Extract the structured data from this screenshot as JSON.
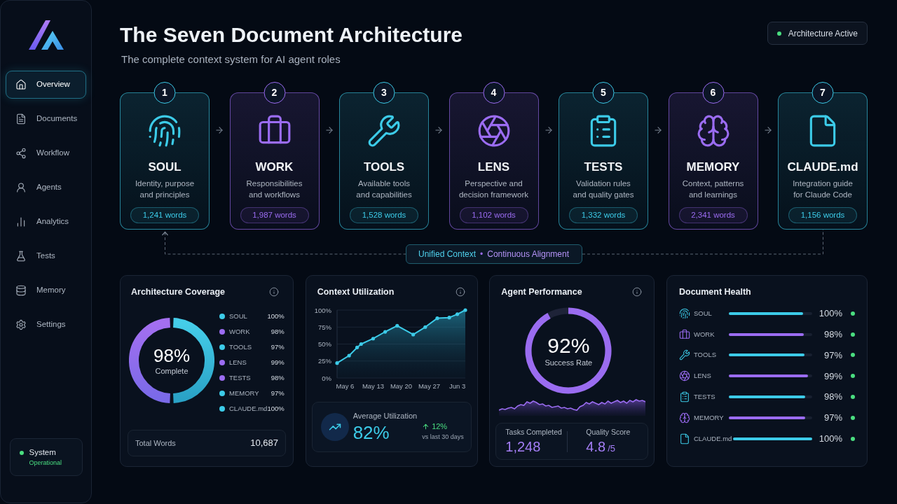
{
  "sidebar": {
    "nav": [
      {
        "label": "Overview",
        "selected": true
      },
      {
        "label": "Documents",
        "selected": false
      },
      {
        "label": "Workflow",
        "selected": false
      },
      {
        "label": "Agents",
        "selected": false
      },
      {
        "label": "Analytics",
        "selected": false
      },
      {
        "label": "Tests",
        "selected": false
      },
      {
        "label": "Memory",
        "selected": false
      },
      {
        "label": "Settings",
        "selected": false
      }
    ],
    "status": {
      "label": "System",
      "state": "Operational"
    }
  },
  "header": {
    "title": "The Seven Document Architecture",
    "subtitle": "The complete context system for AI agent roles",
    "badge": "Architecture Active"
  },
  "documents": [
    {
      "number": "1",
      "name": "SOUL",
      "description": "Identity, purpose\nand principles",
      "words": "1,241 words",
      "color": "#3ccbe8"
    },
    {
      "number": "2",
      "name": "WORK",
      "description": "Responsibilities\nand workflows",
      "words": "1,987 words",
      "color": "#9b6cf2"
    },
    {
      "number": "3",
      "name": "TOOLS",
      "description": "Available tools\nand capabilities",
      "words": "1,528 words",
      "color": "#3ccbe8"
    },
    {
      "number": "4",
      "name": "LENS",
      "description": "Perspective and\ndecision framework",
      "words": "1,102 words",
      "color": "#9b6cf2"
    },
    {
      "number": "5",
      "name": "TESTS",
      "description": "Validation rules\nand quality gates",
      "words": "1,332 words",
      "color": "#3ccbe8"
    },
    {
      "number": "6",
      "name": "MEMORY",
      "description": "Context, patterns\nand learnings",
      "words": "2,341 words",
      "color": "#9b6cf2"
    },
    {
      "number": "7",
      "name": "CLAUDE.md",
      "description": "Integration guide\nfor Claude Code",
      "words": "1,156 words",
      "color": "#3ccbe8"
    }
  ],
  "connector": {
    "left": "Unified Context",
    "separator": "•",
    "right": "Continuous Alignment"
  },
  "coverage": {
    "title": "Architecture Coverage",
    "value": "98%",
    "caption": "Complete",
    "items": [
      {
        "name": "SOUL",
        "value": "100%",
        "color": "#3ccbe8"
      },
      {
        "name": "WORK",
        "value": "98%",
        "color": "#9b6cf2"
      },
      {
        "name": "TOOLS",
        "value": "97%",
        "color": "#3ccbe8"
      },
      {
        "name": "LENS",
        "value": "99%",
        "color": "#9b6cf2"
      },
      {
        "name": "TESTS",
        "value": "98%",
        "color": "#9b6cf2"
      },
      {
        "name": "MEMORY",
        "value": "97%",
        "color": "#3ccbe8"
      },
      {
        "name": "CLAUDE.md",
        "value": "100%",
        "color": "#3ccbe8"
      }
    ],
    "total_label": "Total Words",
    "total_value": "10,687"
  },
  "utilization": {
    "title": "Context Utilization",
    "chart_data": {
      "type": "area",
      "grid": true,
      "categories": [
        null,
        null,
        "May 6",
        null,
        null,
        null,
        null,
        null,
        null,
        "May 13",
        null,
        null,
        null,
        null,
        null,
        null,
        "May 20",
        null,
        null,
        null,
        null,
        null,
        null,
        "May 27",
        null,
        null,
        null,
        null,
        null,
        null,
        "Jun 3",
        null,
        null
      ],
      "values": [
        22,
        null,
        null,
        33,
        null,
        45,
        50,
        null,
        null,
        58,
        null,
        null,
        68,
        null,
        null,
        77,
        null,
        null,
        null,
        64,
        null,
        null,
        75,
        null,
        null,
        88,
        null,
        null,
        89,
        null,
        94,
        null,
        100
      ],
      "ylim": [
        0,
        100
      ],
      "yticks": [
        {
          "value": 0,
          "label": "0%"
        },
        {
          "value": 25,
          "label": "25%"
        },
        {
          "value": 50,
          "label": "50%"
        },
        {
          "value": 75,
          "label": "75%"
        },
        {
          "value": 100,
          "label": "100%"
        }
      ]
    },
    "average_label": "Average Utilization",
    "average_value": "82%",
    "change": "12%",
    "change_caption": "vs last 30 days"
  },
  "performance": {
    "title": "Agent Performance",
    "level": 0.92,
    "value": "92%",
    "caption": "Success Rate",
    "stats": [
      {
        "label": "Tasks Completed",
        "value": "1,248"
      },
      {
        "label": "Quality Score",
        "value": "4.8",
        "suffix": "/5"
      }
    ]
  },
  "health": {
    "title": "Document Health",
    "items": [
      {
        "name": "SOUL",
        "level": 0.89,
        "value": "100%",
        "color": "#3ccbe8"
      },
      {
        "name": "WORK",
        "level": 0.9,
        "value": "98%",
        "color": "#9b6cf2"
      },
      {
        "name": "TOOLS",
        "level": 0.91,
        "value": "97%",
        "color": "#3ccbe8"
      },
      {
        "name": "LENS",
        "level": 0.95,
        "value": "99%",
        "color": "#9b6cf2"
      },
      {
        "name": "TESTS",
        "level": 0.92,
        "value": "98%",
        "color": "#3ccbe8"
      },
      {
        "name": "MEMORY",
        "level": 0.92,
        "value": "97%",
        "color": "#9b6cf2"
      },
      {
        "name": "CLAUDE.md",
        "level": 1.0,
        "value": "100%",
        "color": "#3ccbe8"
      }
    ]
  }
}
